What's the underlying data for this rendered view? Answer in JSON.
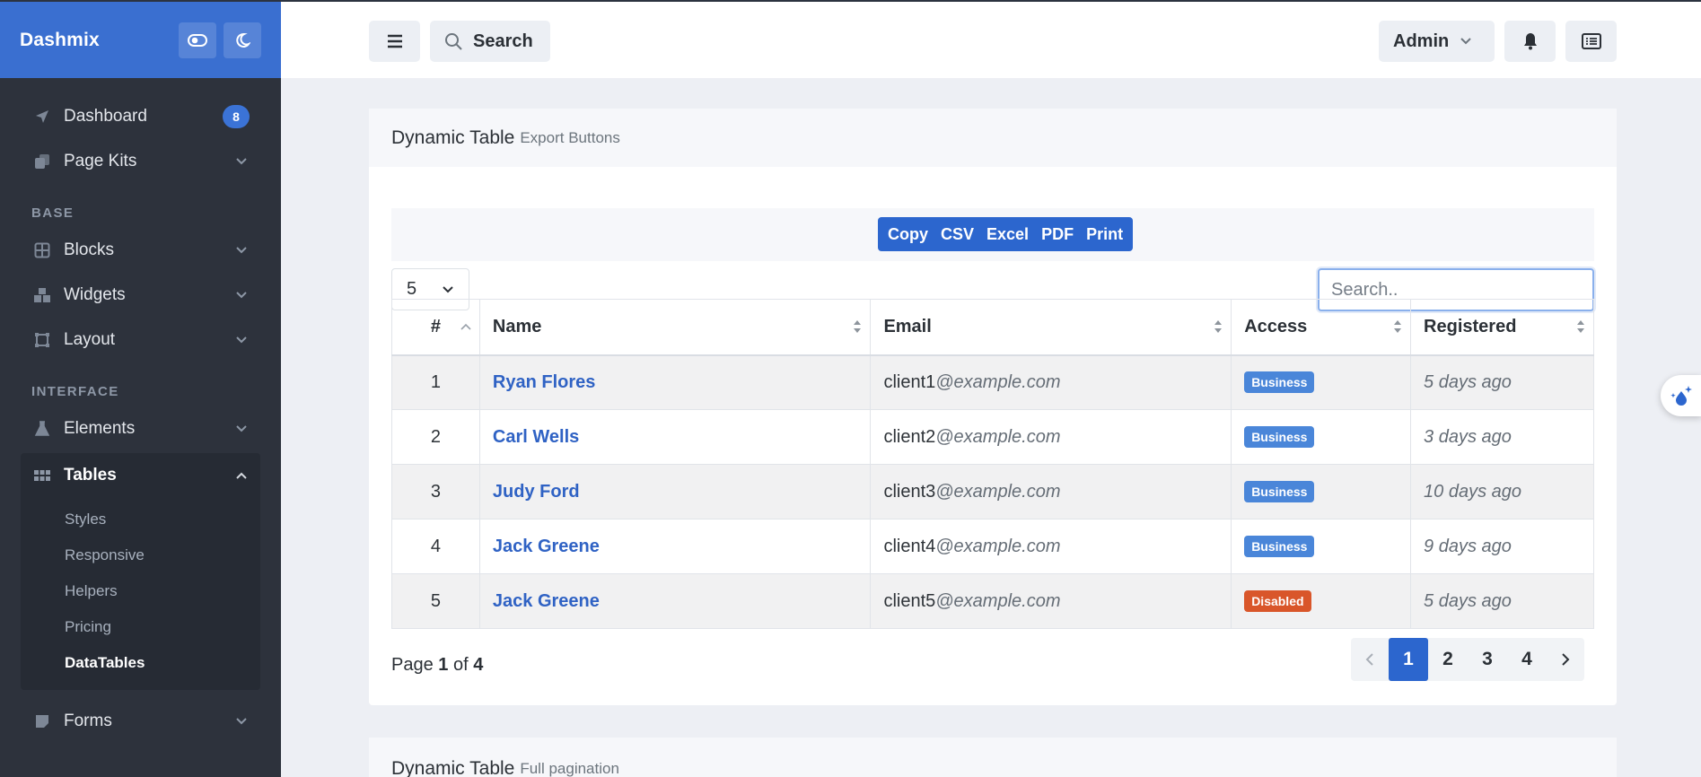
{
  "brand": {
    "name": "Dashmix"
  },
  "sidebar": {
    "items_top": [
      {
        "label": "Dashboard",
        "badge": "8"
      },
      {
        "label": "Page Kits"
      }
    ],
    "heading_base": "BASE",
    "items_base": [
      {
        "label": "Blocks"
      },
      {
        "label": "Widgets"
      },
      {
        "label": "Layout"
      }
    ],
    "heading_interface": "INTERFACE",
    "items_interface": [
      {
        "label": "Elements"
      },
      {
        "label": "Tables"
      }
    ],
    "tables_sub": [
      "Styles",
      "Responsive",
      "Helpers",
      "Pricing",
      "DataTables"
    ],
    "items_after": [
      {
        "label": "Forms"
      }
    ]
  },
  "header": {
    "search_label": "Search",
    "user_label": "Admin"
  },
  "block1": {
    "title": "Dynamic Table",
    "subtitle": "Export Buttons",
    "export_buttons": [
      "Copy",
      "CSV",
      "Excel",
      "PDF",
      "Print"
    ],
    "page_length": "5",
    "search_placeholder": "Search..",
    "columns": [
      "#",
      "Name",
      "Email",
      "Access",
      "Registered"
    ],
    "rows": [
      {
        "num": "1",
        "name": "Ryan Flores",
        "email_user": "client1",
        "email_domain": "@example.com",
        "access": "Business",
        "registered": "5 days ago"
      },
      {
        "num": "2",
        "name": "Carl Wells",
        "email_user": "client2",
        "email_domain": "@example.com",
        "access": "Business",
        "registered": "3 days ago"
      },
      {
        "num": "3",
        "name": "Judy Ford",
        "email_user": "client3",
        "email_domain": "@example.com",
        "access": "Business",
        "registered": "10 days ago"
      },
      {
        "num": "4",
        "name": "Jack Greene",
        "email_user": "client4",
        "email_domain": "@example.com",
        "access": "Business",
        "registered": "9 days ago"
      },
      {
        "num": "5",
        "name": "Jack Greene",
        "email_user": "client5",
        "email_domain": "@example.com",
        "access": "Disabled",
        "registered": "5 days ago"
      }
    ],
    "page_info": {
      "prefix": "Page",
      "current": "1",
      "of": "of",
      "total": "4"
    },
    "pages": [
      "1",
      "2",
      "3",
      "4"
    ]
  },
  "block2": {
    "title": "Dynamic Table",
    "subtitle": "Full pagination"
  },
  "colors": {
    "accent": "#2c66ce",
    "business": "#4a86d9",
    "disabled": "#d9562a",
    "sidebar_bg": "#2d323c"
  }
}
